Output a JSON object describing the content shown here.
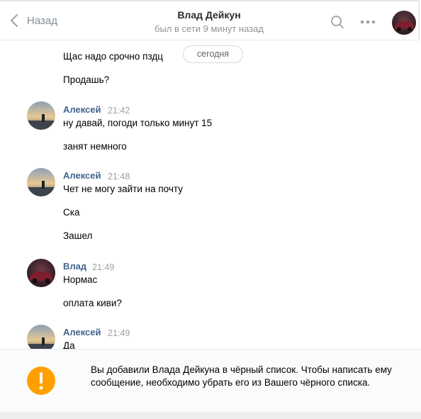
{
  "header": {
    "back_label": "Назад",
    "title": "Влад Дейкун",
    "status": "был в сети 9 минут назад"
  },
  "chat": {
    "date_divider": "сегодня",
    "top_messages": [
      "Щас надо срочно пздц",
      "Продашь?"
    ],
    "groups": [
      {
        "author": "Алексей",
        "time": "21:42",
        "messages": [
          "ну давай, погоди только минут 15",
          "занят немного"
        ]
      },
      {
        "author": "Алексей",
        "time": "21:48",
        "messages": [
          "Чет не могу зайти на почту",
          "Ска",
          "Зашел"
        ]
      },
      {
        "author": "Влад",
        "time": "21:49",
        "messages": [
          "Нормас",
          "оплата киви?"
        ]
      },
      {
        "author": "Алексей",
        "time": "21:49",
        "messages": [
          "Да"
        ]
      }
    ]
  },
  "notice": {
    "text": "Вы добавили Влада Дейкуна в чёрный список. Чтобы написать ему сообщение, необходимо убрать его из Вашего чёрного списка."
  },
  "colors": {
    "author": "#42648b",
    "warning": "#ffa000",
    "muted": "#818c99"
  }
}
